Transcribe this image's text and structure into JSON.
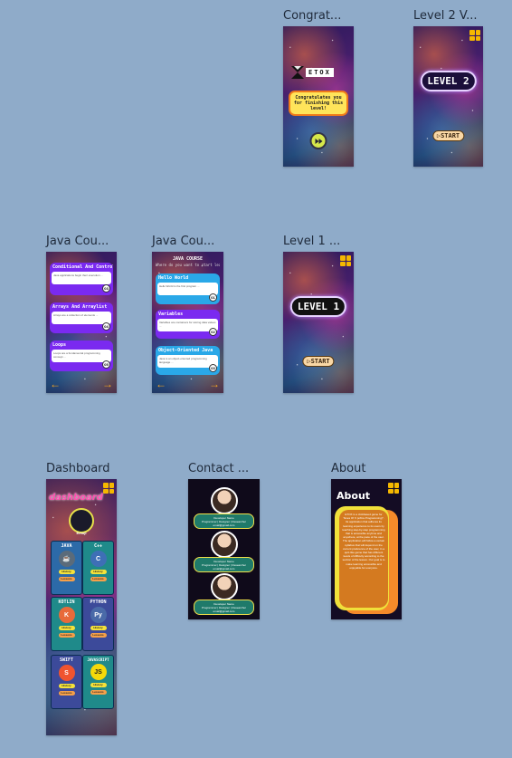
{
  "frames": {
    "congrats": {
      "label": "Congrat...",
      "logo_text": "ETOX",
      "message": "Congratulates you for finishing this level!",
      "next_icon": "next-circle-icon"
    },
    "level2": {
      "label": "Level 2 V...",
      "badge": "LEVEL 2",
      "start": "▷START"
    },
    "java_course_1": {
      "label": "Java Cou...",
      "cards": [
        {
          "title": "Conditional And Control Flow",
          "body": "Java applications begin their execution ...",
          "num": "03"
        },
        {
          "title": "Arrays And Arraylist",
          "body": "Arrays are a collection of elements ...",
          "num": "04"
        },
        {
          "title": "Loops",
          "body": "Loops are a fundamental programming concept ...",
          "num": "05"
        }
      ],
      "prev_icon": "arrow-left-icon",
      "next_icon": "arrow-right-icon"
    },
    "java_course_2": {
      "label": "Java Cou...",
      "header": "JAVA COURSE",
      "subheader": "Where do you want to start learning?",
      "cards": [
        {
          "title": "Hello World",
          "body": "Hello World is the first program ...",
          "num": "01"
        },
        {
          "title": "Variables",
          "body": "Variables are containers for storing data values ...",
          "num": "02"
        },
        {
          "title": "Object-Oriented Java",
          "body": "Java is an object-oriented programming language ...",
          "num": "03"
        }
      ],
      "prev_icon": "arrow-left-icon",
      "next_icon": "arrow-right-icon"
    },
    "level1": {
      "label": "Level 1  ...",
      "badge": "LEVEL 1",
      "start": "▷START"
    },
    "dashboard": {
      "label": "Dashboard",
      "title": "dashboard",
      "user_name": "Emoji",
      "languages": [
        {
          "name": "JAVA",
          "logo": "java-logo",
          "logo_text": "☕",
          "color": "#2c6aa8",
          "logo_bg": "#5b6b7a"
        },
        {
          "name": "C++",
          "logo": "cpp-logo",
          "logo_text": "C",
          "color": "#1f8a8a",
          "logo_bg": "#3e6fb6"
        },
        {
          "name": "KOTLIN",
          "logo": "kotlin-logo",
          "logo_text": "K",
          "color": "#1f8a8a",
          "logo_bg": "#e86a3a"
        },
        {
          "name": "PYTHON",
          "logo": "python-logo",
          "logo_text": "Py",
          "color": "#3c4a9a",
          "logo_bg": "#4a6aa8"
        },
        {
          "name": "SWIFT",
          "logo": "swift-logo",
          "logo_text": "S",
          "color": "#3c4a9a",
          "logo_bg": "#f0542f"
        },
        {
          "name": "JAVASCRIPT",
          "logo": "javascript-logo",
          "logo_text": "JS",
          "color": "#1f8a8a",
          "logo_bg": "#f5d90a"
        }
      ],
      "btn_history": "History",
      "btn_lessons": "Lessons"
    },
    "contact": {
      "label": "Contact ...",
      "people": [
        {
          "name": "Developer Name",
          "role": "Programmer | Designer | Researcher",
          "email": "email@gmail.com"
        },
        {
          "name": "Developer Name",
          "role": "Programmer | Designer | Researcher",
          "email": "email@gmail.com"
        },
        {
          "name": "Developer Name",
          "role": "Programmer | Designer | Researcher",
          "email": "email@gmail.com"
        }
      ]
    },
    "about": {
      "label": "About",
      "title": "About",
      "body": "ETOX is a clickbased game for \"Exes Of X (eXtra Programming)\". Its application that adheres its learning experience to its users by teaching step-by-step programming that is accessible anytime and anywhere, at the pace of the user. The application will follow a certain syllabus that will depend on the current preference of the user, in a quiz-like game that has different levels of difficulty according to the section of the lesson. Our goal is to make learning accessible and enjoyable for everyone."
    }
  },
  "colors": {
    "canvas": "#8fabc9",
    "accent_gold": "#f5b800",
    "dashboard_title": "#ff4fb0"
  }
}
